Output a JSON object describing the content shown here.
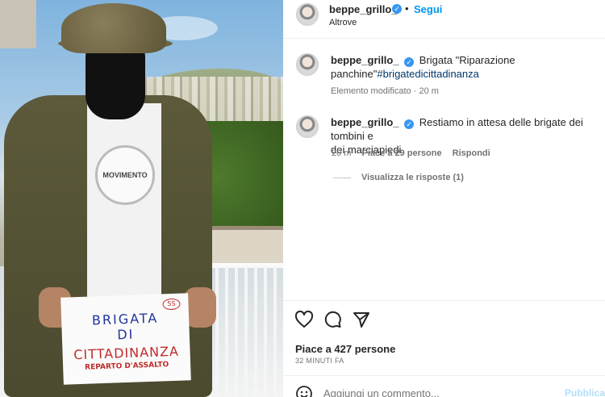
{
  "post": {
    "author": "beppe_grillo_",
    "follow_label": "Segui",
    "location": "Altrove",
    "image_sign": {
      "line1": "BRIGATA",
      "line2": "DI",
      "line3": "CITTADINANZA",
      "line4": "REPARTO D'ASSALTO",
      "badge": "5S"
    },
    "shirt_logo": "MOVIMENTO"
  },
  "caption": {
    "author": "beppe_grillo_",
    "text_part1": "Brigata \"Riparazione",
    "text_part2": "panchine\"",
    "hashtag": "#brigatedicittadinanza",
    "edited_label": "Elemento modificato",
    "time": "20 m"
  },
  "comment": {
    "author": "beppe_grillo_",
    "text_line1": "Restiamo in attesa delle brigate dei tombini e",
    "text_line2": "dei marciapiedi",
    "time": "20 m",
    "likes": "Piace a 29 persone",
    "reply_label": "Rispondi",
    "view_replies": "Visualizza le risposte (1)"
  },
  "actions": {
    "likes_summary": "Piace a 427 persone",
    "timestamp": "32 MINUTI FA",
    "comment_placeholder": "Aggiungi un commento...",
    "publish_label": "Pubblica"
  },
  "colors": {
    "link_blue": "#0095f6",
    "verified_blue": "#3897f0",
    "hashtag": "#00376b"
  }
}
